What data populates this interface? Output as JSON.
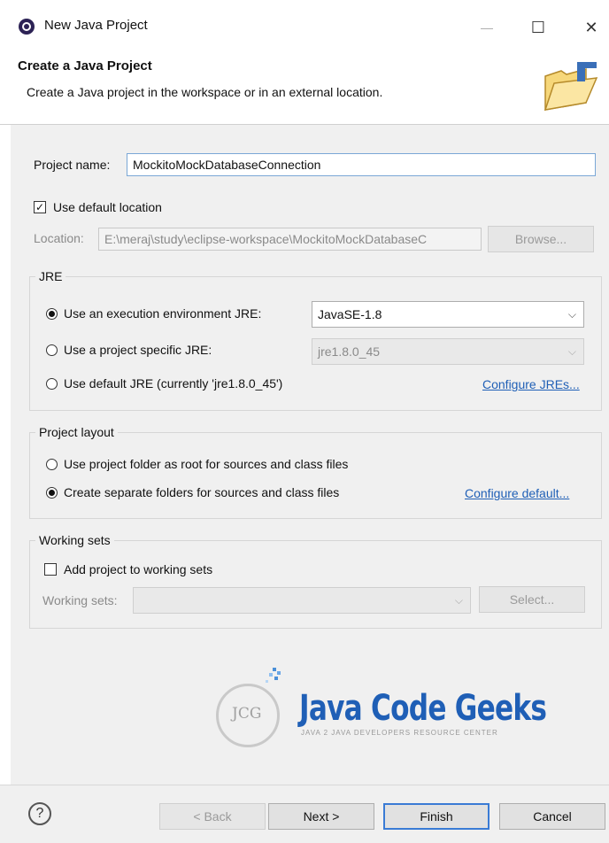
{
  "window": {
    "title": "New Java Project",
    "minimize": "—",
    "maximize": "☐",
    "close": "✕"
  },
  "header": {
    "title": "Create a Java Project",
    "description": "Create a Java project in the workspace or in an external location."
  },
  "project": {
    "name_label": "Project name:",
    "name_value": "MockitoMockDatabaseConnection"
  },
  "location": {
    "use_default_label": "Use default location",
    "use_default_checked": true,
    "label": "Location:",
    "value": "E:\\meraj\\study\\eclipse-workspace\\MockitoMockDatabaseC",
    "browse_label": "Browse..."
  },
  "jre": {
    "title": "JRE",
    "opt_env_label": "Use an execution environment JRE:",
    "opt_env_value": "JavaSE-1.8",
    "opt_project_label": "Use a project specific JRE:",
    "opt_project_value": "jre1.8.0_45",
    "opt_default_label": "Use default JRE (currently 'jre1.8.0_45')",
    "configure_link": "Configure JREs..."
  },
  "layout": {
    "title": "Project layout",
    "opt_root_label": "Use project folder as root for sources and class files",
    "opt_separate_label": "Create separate folders for sources and class files",
    "configure_link": "Configure default..."
  },
  "working_sets": {
    "title": "Working sets",
    "add_label": "Add project to working sets",
    "sets_label": "Working sets:",
    "select_label": "Select..."
  },
  "logo": {
    "initials": "JCG",
    "name": "Java Code Geeks",
    "tagline": "JAVA 2 JAVA DEVELOPERS RESOURCE CENTER"
  },
  "footer": {
    "help": "?",
    "back": "< Back",
    "next": "Next >",
    "finish": "Finish",
    "cancel": "Cancel"
  }
}
